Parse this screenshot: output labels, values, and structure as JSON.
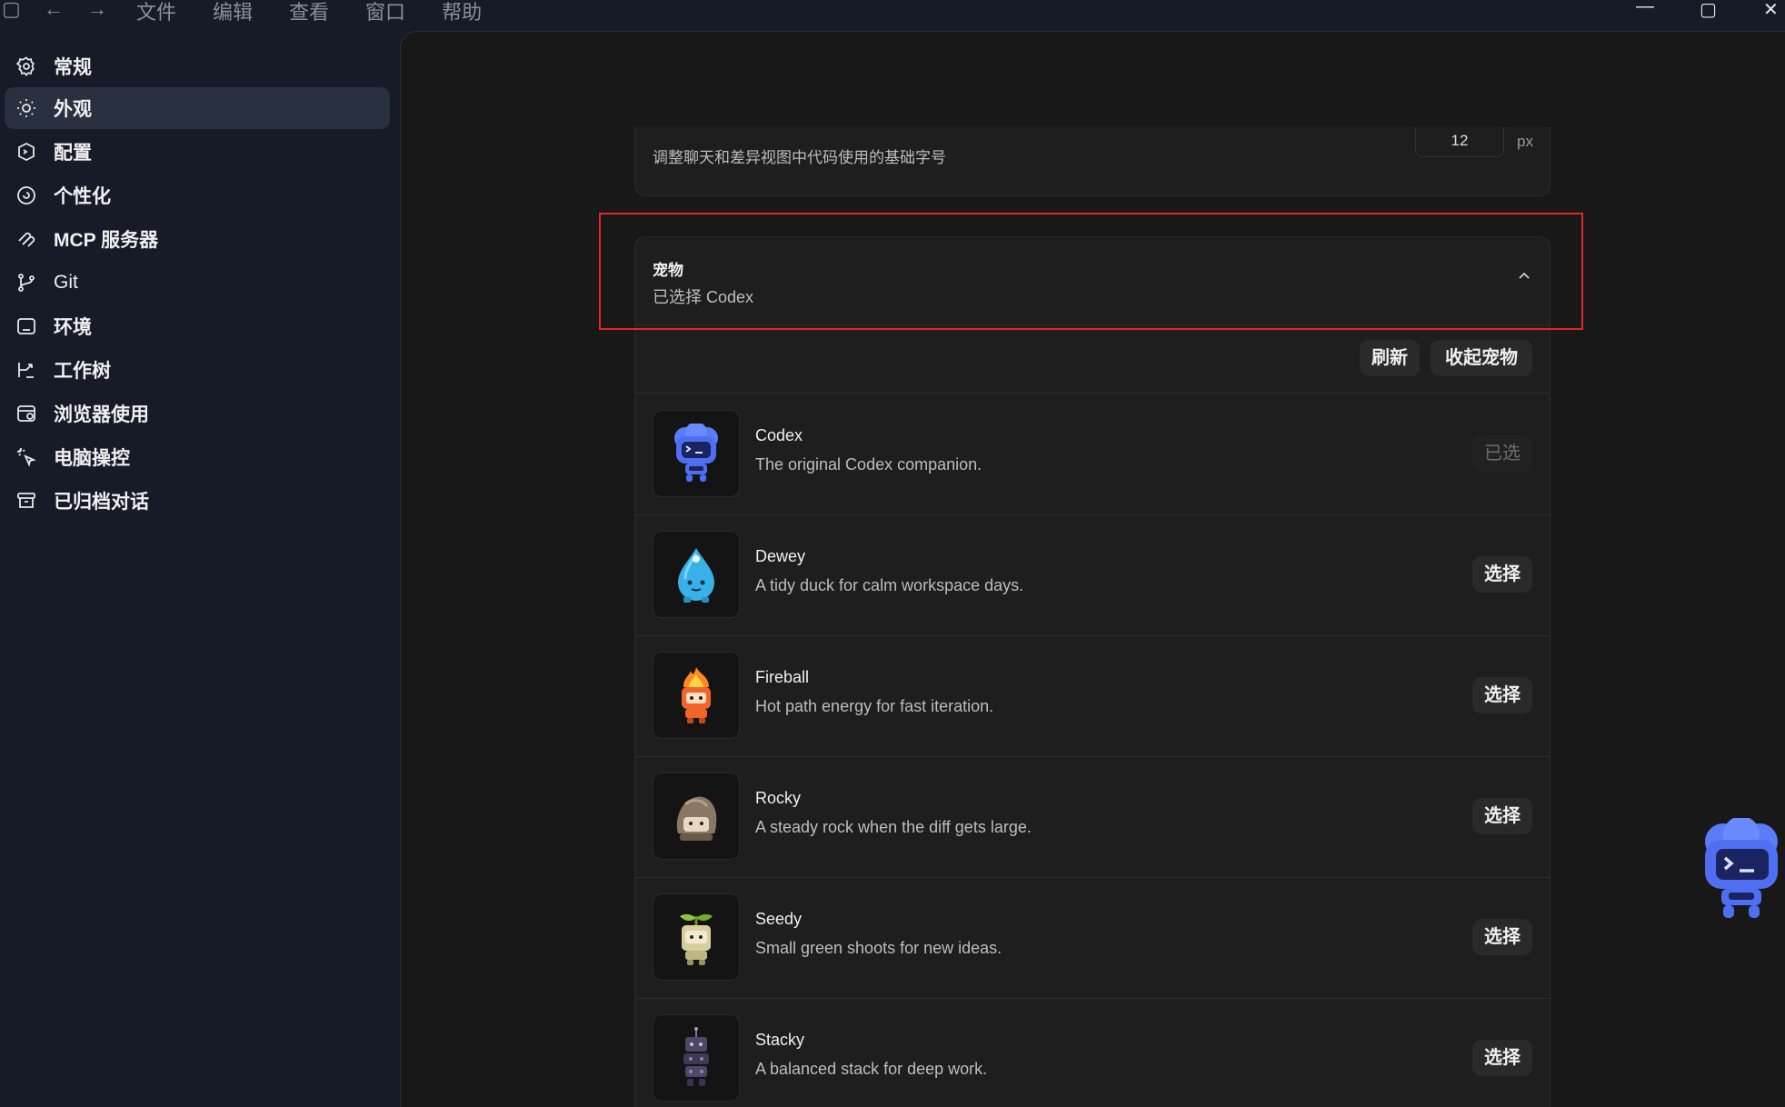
{
  "titlebar": {
    "menu": [
      "文件",
      "编辑",
      "查看",
      "窗口",
      "帮助"
    ],
    "icons": [
      "sidebar-toggle-icon",
      "back-arrow-icon",
      "forward-arrow-icon",
      "minimize-icon",
      "maximize-icon",
      "close-icon"
    ]
  },
  "sidebar": {
    "items": [
      {
        "label": "常规",
        "icon": "gear-icon"
      },
      {
        "label": "外观",
        "icon": "sun-icon",
        "active": true
      },
      {
        "label": "配置",
        "icon": "config-icon"
      },
      {
        "label": "个性化",
        "icon": "personalize-icon"
      },
      {
        "label": "MCP 服务器",
        "icon": "mcp-icon"
      },
      {
        "label": "Git",
        "icon": "git-branch-icon"
      },
      {
        "label": "环境",
        "icon": "terminal-icon"
      },
      {
        "label": "工作树",
        "icon": "worktree-icon"
      },
      {
        "label": "浏览器使用",
        "icon": "browser-icon"
      },
      {
        "label": "电脑操控",
        "icon": "cursor-sparkle-icon"
      },
      {
        "label": "已归档对话",
        "icon": "archive-icon"
      }
    ]
  },
  "font_setting": {
    "description": "调整聊天和差异视图中代码使用的基础字号",
    "value": "12",
    "unit": "px"
  },
  "pets": {
    "title": "宠物",
    "subtitle": "已选择 Codex",
    "refresh_label": "刷新",
    "collapse_label": "收起宠物",
    "items": [
      {
        "name": "Codex",
        "description": "The original Codex companion.",
        "action": "已选",
        "selected": true,
        "icon": "codex-pet-icon"
      },
      {
        "name": "Dewey",
        "description": "A tidy duck for calm workspace days.",
        "action": "选择",
        "selected": false,
        "icon": "dewey-pet-icon"
      },
      {
        "name": "Fireball",
        "description": "Hot path energy for fast iteration.",
        "action": "选择",
        "selected": false,
        "icon": "fireball-pet-icon"
      },
      {
        "name": "Rocky",
        "description": "A steady rock when the diff gets large.",
        "action": "选择",
        "selected": false,
        "icon": "rocky-pet-icon"
      },
      {
        "name": "Seedy",
        "description": "Small green shoots for new ideas.",
        "action": "选择",
        "selected": false,
        "icon": "seedy-pet-icon"
      },
      {
        "name": "Stacky",
        "description": "A balanced stack for deep work.",
        "action": "选择",
        "selected": false,
        "icon": "stacky-pet-icon"
      }
    ]
  },
  "colors": {
    "highlight": "#e3262b",
    "sidebar_bg": "#151b27",
    "main_bg": "#181818",
    "codex_blue": "#4a6cf7"
  }
}
